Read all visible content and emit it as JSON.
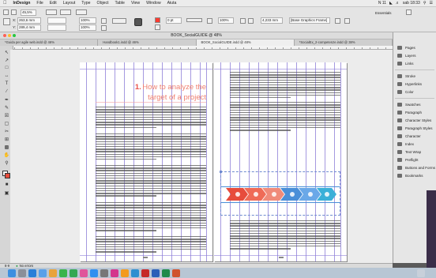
{
  "menubar": {
    "apple": "",
    "app": "InDesign",
    "items": [
      "File",
      "Edit",
      "Layout",
      "Type",
      "Object",
      "Table",
      "View",
      "Window",
      "Aiuta"
    ],
    "right": [
      "N 11",
      "sab 18:33"
    ]
  },
  "control": {
    "x_value": "263,6 mm",
    "y_value": "289,4 mm",
    "zoom_a": "45,5%",
    "zoom_b": "100%",
    "stroke": "0 pt",
    "width_value": "4,233 mm",
    "style_field": "[Base Graphics Frame]",
    "workspace": "Essentials"
  },
  "document": {
    "title": "BOOK_SocialGUIDE @ 48%",
    "tabs": [
      "*Guida per agile web.indd @ 46%",
      "Handbook1.indd @ 46%",
      "BOOK_SocialGUIDE.indd @ 48%",
      "*SocialEx_2-competenze.indd @ 38%"
    ],
    "active_tab": 2
  },
  "content": {
    "chapter_number": "1.",
    "chapter_title_line1": "How to analyze the",
    "chapter_title_line2": "target of a project"
  },
  "status": {
    "page": "8-9",
    "preflight": "No errors"
  },
  "panels": [
    "Pages",
    "Layers",
    "Links",
    "Stroke",
    "Hyperlinks",
    "Color",
    "Swatches",
    "Paragraph",
    "Character Styles",
    "Paragraph Styles",
    "Character",
    "Index",
    "Text Wrap",
    "Preflight",
    "Buttons and Forms",
    "Bookmarks"
  ],
  "colors": {
    "accent_red": "#e8504a",
    "guide_purple": "#8e7fd8",
    "infographic": [
      "#e74c3c",
      "#ef6b57",
      "#f08b7a",
      "#4a8fd8",
      "#6aa8e8",
      "#3bb0d8"
    ]
  },
  "dock_apps": [
    "finder",
    "launchpad",
    "safari",
    "mail",
    "photos",
    "messages",
    "facetime",
    "itunes",
    "appstore",
    "preferences",
    "indesign",
    "illustrator",
    "photoshop",
    "acrobat",
    "word",
    "excel",
    "powerpoint",
    "trash"
  ]
}
